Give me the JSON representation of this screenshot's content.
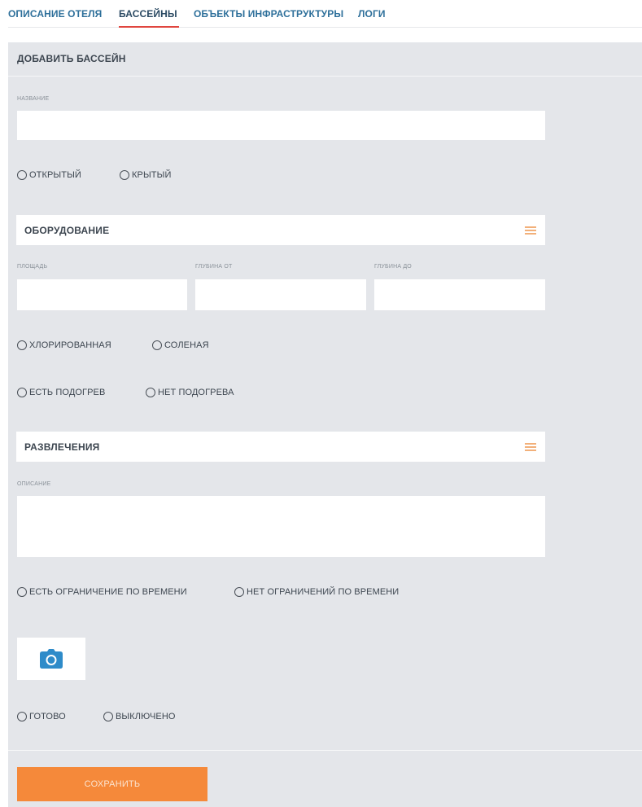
{
  "tabs": [
    {
      "label": "ОПИСАНИЕ ОТЕЛЯ"
    },
    {
      "label": "БАССЕЙНЫ"
    },
    {
      "label": "ОБЪЕКТЫ ИНФРАСТРУКТУРЫ"
    },
    {
      "label": "ЛОГИ"
    }
  ],
  "active_tab": "БАССЕЙНЫ",
  "panel": {
    "title": "ДОБАВИТЬ БАССЕЙН",
    "name_label": "НАЗВАНИЕ",
    "name_value": "",
    "type_options": [
      "ОТКРЫТЫЙ",
      "КРЫТЫЙ"
    ],
    "equipment": {
      "title": "ОБОРУДОВАНИЕ",
      "area_label": "ПЛОЩАДЬ",
      "depth_from_label": "ГЛУБИНА ОТ",
      "depth_to_label": "ГЛУБИНА ДО",
      "water_options": [
        "ХЛОРИРОВАННАЯ",
        "СОЛЕНАЯ"
      ],
      "heating_options": [
        "ЕСТЬ ПОДОГРЕВ",
        "НЕТ ПОДОГРЕВА"
      ]
    },
    "entertainment": {
      "title": "РАЗВЛЕЧЕНИЯ",
      "description_label": "ОПИСАНИЕ",
      "time_options": [
        "ЕСТЬ ОГРАНИЧЕНИЕ ПО ВРЕМЕНИ",
        "НЕТ ОГРАНИЧЕНИЙ ПО ВРЕМЕНИ"
      ]
    },
    "status_options": [
      "ГОТОВО",
      "ВЫКЛЮЧЕНО"
    ],
    "save_label": "СОХРАНИТЬ"
  },
  "icons": {
    "section_menu": "hamburger-icon",
    "photo": "camera-icon"
  },
  "colors": {
    "tab_link": "#2d6f9a",
    "tab_underline": "#e0463f",
    "panel_bg": "#e4e6ea",
    "save_button": "#f5893a",
    "menu_icon": "#f2b07a",
    "camera_icon": "#2e8bc9"
  }
}
